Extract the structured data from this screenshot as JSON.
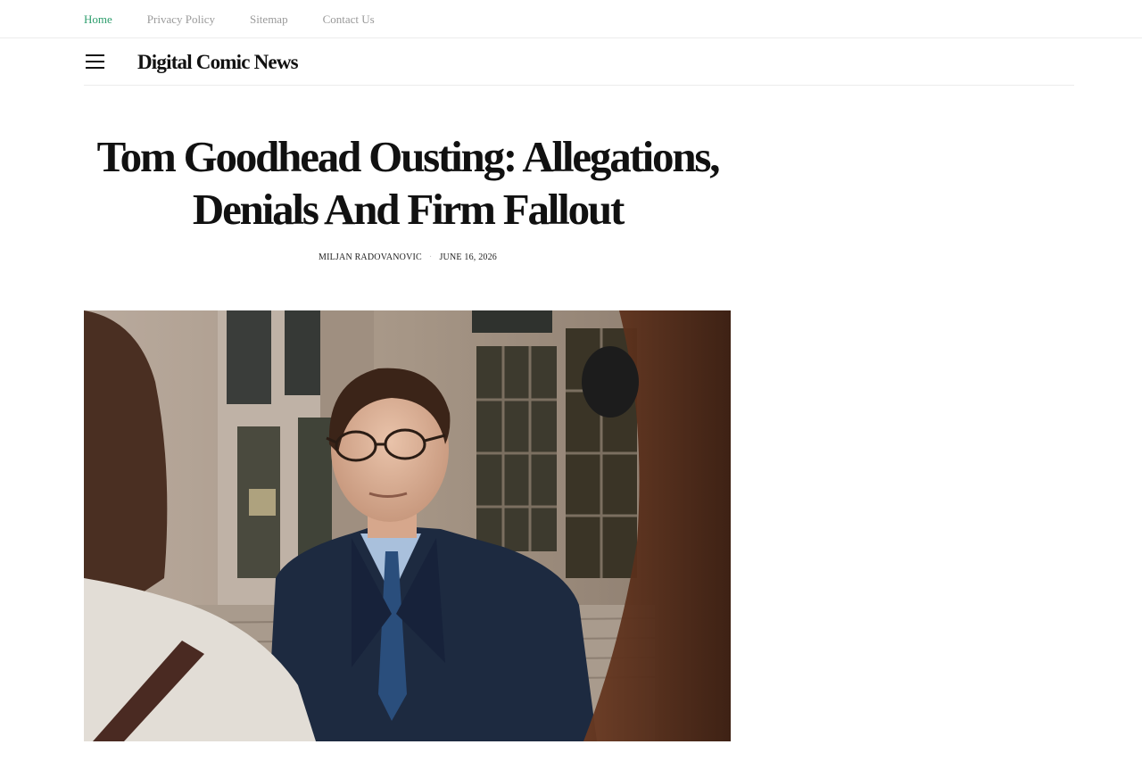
{
  "topnav": {
    "items": [
      {
        "label": "Home",
        "active": true
      },
      {
        "label": "Privacy Policy",
        "active": false
      },
      {
        "label": "Sitemap",
        "active": false
      },
      {
        "label": "Contact Us",
        "active": false
      }
    ]
  },
  "header": {
    "menu_icon": "hamburger-menu-icon",
    "site_title": "Digital Comic News"
  },
  "article": {
    "title": "Tom Goodhead Ousting: Allegations, Denials And Firm Fallout",
    "author": "MILJAN RADOVANOVIC",
    "separator": "·",
    "date": "JUNE 16, 2026"
  },
  "colors": {
    "accent": "#2f9e6e",
    "nav_text": "#9a9a9a",
    "title_text": "#111111"
  }
}
